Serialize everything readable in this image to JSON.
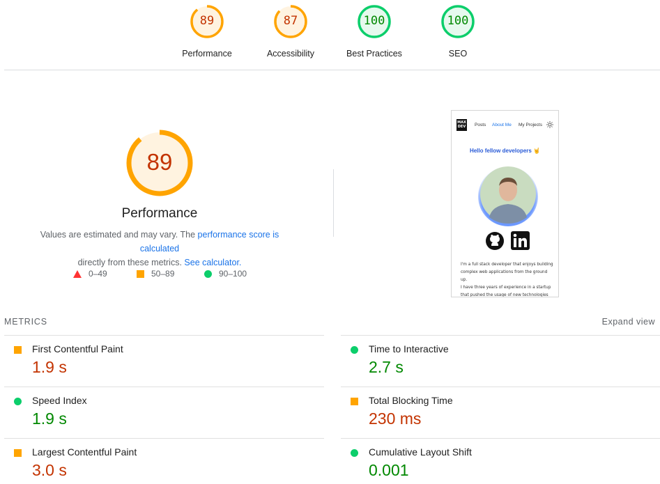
{
  "gauges": [
    {
      "score": "89",
      "label": "Performance",
      "rating": "average",
      "fraction": 0.89
    },
    {
      "score": "87",
      "label": "Accessibility",
      "rating": "average",
      "fraction": 0.87
    },
    {
      "score": "100",
      "label": "Best Practices",
      "rating": "pass",
      "fraction": 1.0
    },
    {
      "score": "100",
      "label": "SEO",
      "rating": "pass",
      "fraction": 1.0
    }
  ],
  "performance": {
    "score": "89",
    "fraction": 0.89,
    "title": "Performance",
    "desc_prefix": "Values are estimated and may vary. The ",
    "desc_link1": "performance score is calculated",
    "desc_middle": " directly from these metrics. ",
    "desc_link2": "See calculator."
  },
  "legend": {
    "fail": "0–49",
    "average": "50–89",
    "pass": "90–100"
  },
  "screenshot": {
    "logo": "MAX DEV",
    "nav": [
      "Posts",
      "About Me",
      "My Projects"
    ],
    "active_nav": "About Me",
    "hello": "Hello fellow developers 🤘",
    "bio": [
      "I'm a full stack developer that enjoys building",
      "complex web applications from the ground up.",
      "I have three years of experience in a startup",
      "that pushed the usage of new technologies and"
    ]
  },
  "metrics": {
    "header": "METRICS",
    "expand": "Expand view",
    "items": [
      {
        "label": "First Contentful Paint",
        "value": "1.9 s",
        "rating": "average"
      },
      {
        "label": "Time to Interactive",
        "value": "2.7 s",
        "rating": "pass"
      },
      {
        "label": "Speed Index",
        "value": "1.9 s",
        "rating": "pass"
      },
      {
        "label": "Total Blocking Time",
        "value": "230 ms",
        "rating": "average"
      },
      {
        "label": "Largest Contentful Paint",
        "value": "3.0 s",
        "rating": "average"
      },
      {
        "label": "Cumulative Layout Shift",
        "value": "0.001",
        "rating": "pass"
      }
    ]
  },
  "colors": {
    "average_stroke": "#ffa400",
    "average_fill": "#fff3e0",
    "average_text": "#c33300",
    "pass_stroke": "#0cce6b",
    "pass_fill": "#e6f9ee",
    "pass_text": "#008800",
    "fail": "#ff3333",
    "link": "#1a73e8"
  }
}
